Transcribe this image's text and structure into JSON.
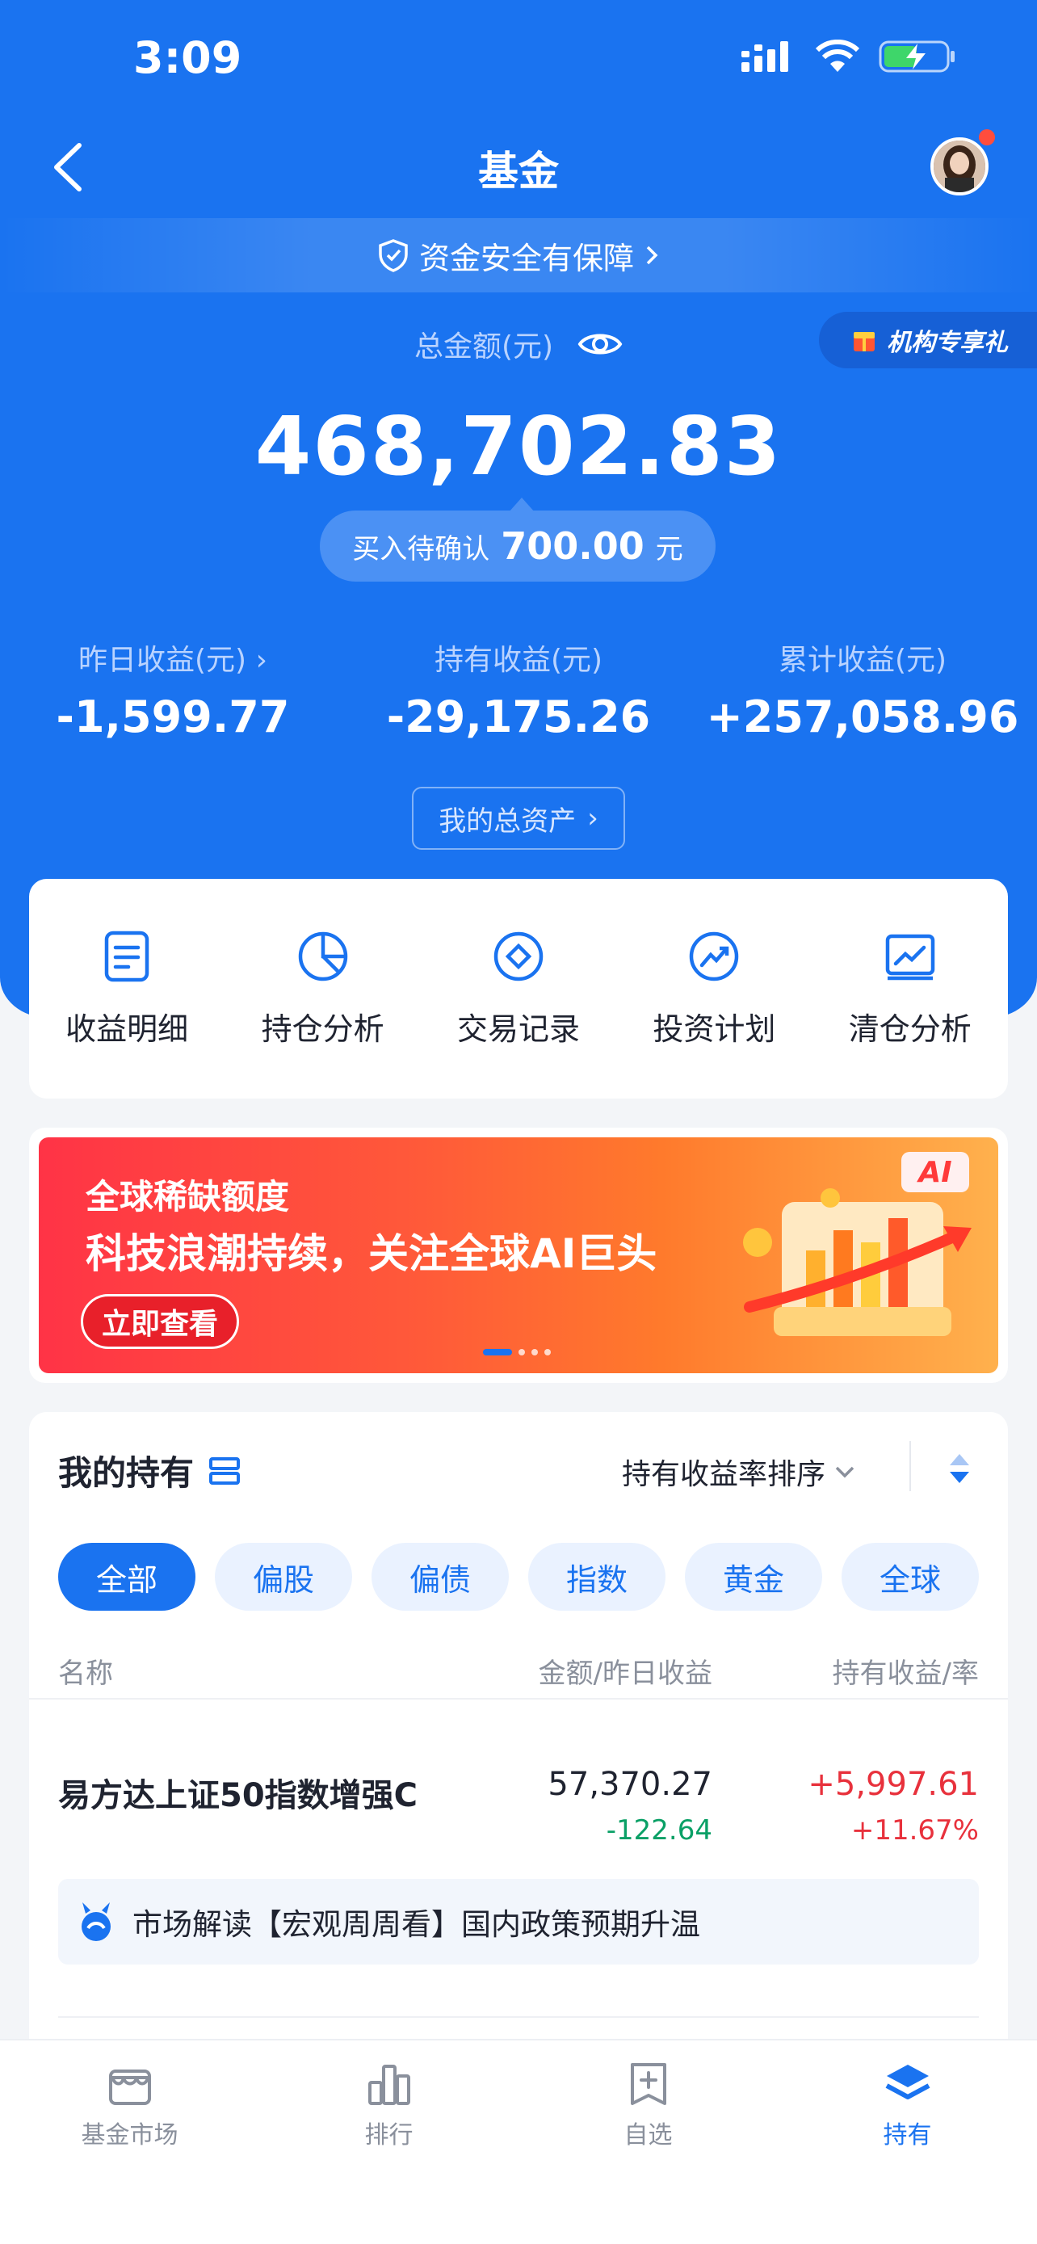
{
  "status": {
    "time": "3:09"
  },
  "nav": {
    "title": "基金"
  },
  "safety": {
    "text": "资金安全有保障"
  },
  "promo_tag": {
    "text": "机构专享礼"
  },
  "total": {
    "label": "总金额(元)",
    "amount": "468,702.83"
  },
  "pending": {
    "label": "买入待确认",
    "amount": "700.00",
    "unit": "元"
  },
  "stats": [
    {
      "label": "昨日收益(元)",
      "value": "-1,599.77"
    },
    {
      "label": "持有收益(元)",
      "value": "-29,175.26"
    },
    {
      "label": "累计收益(元)",
      "value": "+257,058.96"
    }
  ],
  "assets_button": "我的总资产",
  "quick": [
    {
      "label": "收益明细",
      "icon": "document-icon"
    },
    {
      "label": "持仓分析",
      "icon": "pie-chart-icon"
    },
    {
      "label": "交易记录",
      "icon": "record-icon"
    },
    {
      "label": "投资计划",
      "icon": "trend-icon"
    },
    {
      "label": "清仓分析",
      "icon": "chart-icon"
    }
  ],
  "banner": {
    "tag": "全球稀缺额度",
    "title": "科技浪潮持续，关注全球AI巨头",
    "button": "立即查看",
    "badge": "AI"
  },
  "holdings": {
    "title": "我的持有",
    "sort_label": "持有收益率排序",
    "chips": [
      "全部",
      "偏股",
      "偏债",
      "指数",
      "黄金",
      "全球"
    ],
    "columns": [
      "名称",
      "金额/昨日收益",
      "持有收益/率"
    ],
    "rows": [
      {
        "name": "易方达上证50指数增强C",
        "amount": "57,370.27",
        "day": "-122.64",
        "hold": "+5,997.61",
        "rate": "+11.67%"
      }
    ],
    "insight": "市场解读【宏观周周看】国内政策预期升温"
  },
  "tabs": [
    {
      "label": "基金市场",
      "icon": "store-icon"
    },
    {
      "label": "排行",
      "icon": "ranking-icon"
    },
    {
      "label": "自选",
      "icon": "bookmark-add-icon"
    },
    {
      "label": "持有",
      "icon": "layers-icon"
    }
  ],
  "colors": {
    "brand": "#1a73f0",
    "up": "#e8313c",
    "down": "#0aa066"
  }
}
